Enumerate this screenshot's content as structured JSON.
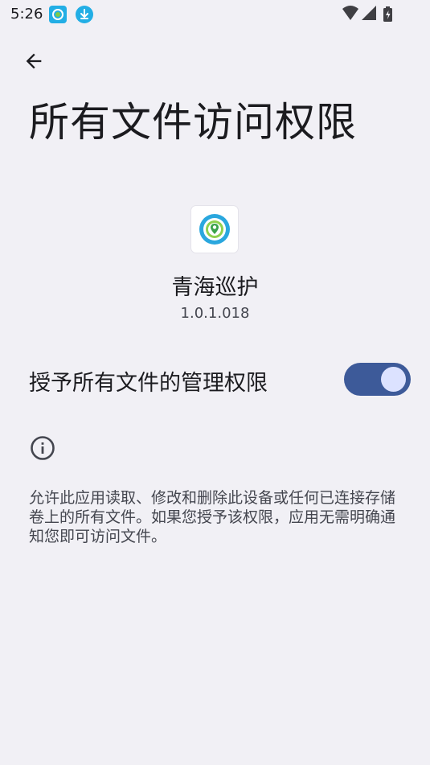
{
  "status_bar": {
    "time": "5:26",
    "notification_icons": [
      "app-notification-icon",
      "download-icon"
    ],
    "right_icons": [
      "wifi-icon",
      "signal-icon",
      "battery-icon"
    ]
  },
  "header": {
    "back_icon": "arrow-back-icon",
    "title": "所有文件访问权限"
  },
  "app": {
    "name": "青海巡护",
    "version": "1.0.1.018"
  },
  "permission": {
    "label": "授予所有文件的管理权限",
    "enabled": true
  },
  "info": {
    "icon": "info-icon",
    "description": "允许此应用读取、修改和删除此设备或任何已连接存储卷上的所有文件。如果您授予该权限，应用无需明确通知您即可访问文件。"
  },
  "colors": {
    "background": "#f1f0f5",
    "switch_track": "#3d5a99",
    "switch_knob": "#dce2ff",
    "notification_accent": "#22aee5"
  }
}
